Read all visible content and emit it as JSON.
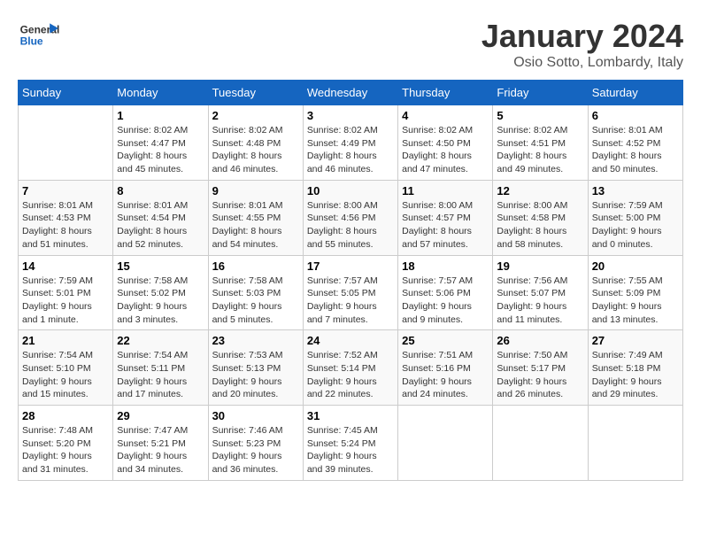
{
  "header": {
    "logo": {
      "line1": "General",
      "line2": "Blue"
    },
    "title": "January 2024",
    "subtitle": "Osio Sotto, Lombardy, Italy"
  },
  "weekdays": [
    "Sunday",
    "Monday",
    "Tuesday",
    "Wednesday",
    "Thursday",
    "Friday",
    "Saturday"
  ],
  "weeks": [
    [
      {
        "day": "",
        "sunrise": "",
        "sunset": "",
        "daylight": ""
      },
      {
        "day": "1",
        "sunrise": "Sunrise: 8:02 AM",
        "sunset": "Sunset: 4:47 PM",
        "daylight": "Daylight: 8 hours and 45 minutes."
      },
      {
        "day": "2",
        "sunrise": "Sunrise: 8:02 AM",
        "sunset": "Sunset: 4:48 PM",
        "daylight": "Daylight: 8 hours and 46 minutes."
      },
      {
        "day": "3",
        "sunrise": "Sunrise: 8:02 AM",
        "sunset": "Sunset: 4:49 PM",
        "daylight": "Daylight: 8 hours and 46 minutes."
      },
      {
        "day": "4",
        "sunrise": "Sunrise: 8:02 AM",
        "sunset": "Sunset: 4:50 PM",
        "daylight": "Daylight: 8 hours and 47 minutes."
      },
      {
        "day": "5",
        "sunrise": "Sunrise: 8:02 AM",
        "sunset": "Sunset: 4:51 PM",
        "daylight": "Daylight: 8 hours and 49 minutes."
      },
      {
        "day": "6",
        "sunrise": "Sunrise: 8:01 AM",
        "sunset": "Sunset: 4:52 PM",
        "daylight": "Daylight: 8 hours and 50 minutes."
      }
    ],
    [
      {
        "day": "7",
        "sunrise": "Sunrise: 8:01 AM",
        "sunset": "Sunset: 4:53 PM",
        "daylight": "Daylight: 8 hours and 51 minutes."
      },
      {
        "day": "8",
        "sunrise": "Sunrise: 8:01 AM",
        "sunset": "Sunset: 4:54 PM",
        "daylight": "Daylight: 8 hours and 52 minutes."
      },
      {
        "day": "9",
        "sunrise": "Sunrise: 8:01 AM",
        "sunset": "Sunset: 4:55 PM",
        "daylight": "Daylight: 8 hours and 54 minutes."
      },
      {
        "day": "10",
        "sunrise": "Sunrise: 8:00 AM",
        "sunset": "Sunset: 4:56 PM",
        "daylight": "Daylight: 8 hours and 55 minutes."
      },
      {
        "day": "11",
        "sunrise": "Sunrise: 8:00 AM",
        "sunset": "Sunset: 4:57 PM",
        "daylight": "Daylight: 8 hours and 57 minutes."
      },
      {
        "day": "12",
        "sunrise": "Sunrise: 8:00 AM",
        "sunset": "Sunset: 4:58 PM",
        "daylight": "Daylight: 8 hours and 58 minutes."
      },
      {
        "day": "13",
        "sunrise": "Sunrise: 7:59 AM",
        "sunset": "Sunset: 5:00 PM",
        "daylight": "Daylight: 9 hours and 0 minutes."
      }
    ],
    [
      {
        "day": "14",
        "sunrise": "Sunrise: 7:59 AM",
        "sunset": "Sunset: 5:01 PM",
        "daylight": "Daylight: 9 hours and 1 minute."
      },
      {
        "day": "15",
        "sunrise": "Sunrise: 7:58 AM",
        "sunset": "Sunset: 5:02 PM",
        "daylight": "Daylight: 9 hours and 3 minutes."
      },
      {
        "day": "16",
        "sunrise": "Sunrise: 7:58 AM",
        "sunset": "Sunset: 5:03 PM",
        "daylight": "Daylight: 9 hours and 5 minutes."
      },
      {
        "day": "17",
        "sunrise": "Sunrise: 7:57 AM",
        "sunset": "Sunset: 5:05 PM",
        "daylight": "Daylight: 9 hours and 7 minutes."
      },
      {
        "day": "18",
        "sunrise": "Sunrise: 7:57 AM",
        "sunset": "Sunset: 5:06 PM",
        "daylight": "Daylight: 9 hours and 9 minutes."
      },
      {
        "day": "19",
        "sunrise": "Sunrise: 7:56 AM",
        "sunset": "Sunset: 5:07 PM",
        "daylight": "Daylight: 9 hours and 11 minutes."
      },
      {
        "day": "20",
        "sunrise": "Sunrise: 7:55 AM",
        "sunset": "Sunset: 5:09 PM",
        "daylight": "Daylight: 9 hours and 13 minutes."
      }
    ],
    [
      {
        "day": "21",
        "sunrise": "Sunrise: 7:54 AM",
        "sunset": "Sunset: 5:10 PM",
        "daylight": "Daylight: 9 hours and 15 minutes."
      },
      {
        "day": "22",
        "sunrise": "Sunrise: 7:54 AM",
        "sunset": "Sunset: 5:11 PM",
        "daylight": "Daylight: 9 hours and 17 minutes."
      },
      {
        "day": "23",
        "sunrise": "Sunrise: 7:53 AM",
        "sunset": "Sunset: 5:13 PM",
        "daylight": "Daylight: 9 hours and 20 minutes."
      },
      {
        "day": "24",
        "sunrise": "Sunrise: 7:52 AM",
        "sunset": "Sunset: 5:14 PM",
        "daylight": "Daylight: 9 hours and 22 minutes."
      },
      {
        "day": "25",
        "sunrise": "Sunrise: 7:51 AM",
        "sunset": "Sunset: 5:16 PM",
        "daylight": "Daylight: 9 hours and 24 minutes."
      },
      {
        "day": "26",
        "sunrise": "Sunrise: 7:50 AM",
        "sunset": "Sunset: 5:17 PM",
        "daylight": "Daylight: 9 hours and 26 minutes."
      },
      {
        "day": "27",
        "sunrise": "Sunrise: 7:49 AM",
        "sunset": "Sunset: 5:18 PM",
        "daylight": "Daylight: 9 hours and 29 minutes."
      }
    ],
    [
      {
        "day": "28",
        "sunrise": "Sunrise: 7:48 AM",
        "sunset": "Sunset: 5:20 PM",
        "daylight": "Daylight: 9 hours and 31 minutes."
      },
      {
        "day": "29",
        "sunrise": "Sunrise: 7:47 AM",
        "sunset": "Sunset: 5:21 PM",
        "daylight": "Daylight: 9 hours and 34 minutes."
      },
      {
        "day": "30",
        "sunrise": "Sunrise: 7:46 AM",
        "sunset": "Sunset: 5:23 PM",
        "daylight": "Daylight: 9 hours and 36 minutes."
      },
      {
        "day": "31",
        "sunrise": "Sunrise: 7:45 AM",
        "sunset": "Sunset: 5:24 PM",
        "daylight": "Daylight: 9 hours and 39 minutes."
      },
      {
        "day": "",
        "sunrise": "",
        "sunset": "",
        "daylight": ""
      },
      {
        "day": "",
        "sunrise": "",
        "sunset": "",
        "daylight": ""
      },
      {
        "day": "",
        "sunrise": "",
        "sunset": "",
        "daylight": ""
      }
    ]
  ]
}
